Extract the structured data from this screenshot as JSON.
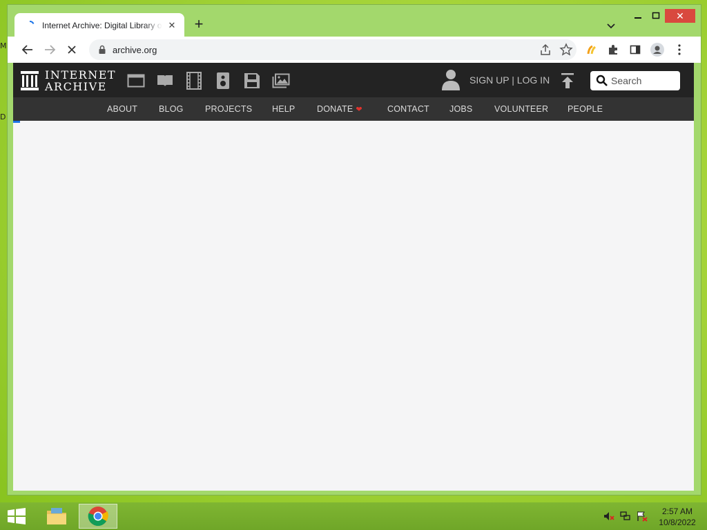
{
  "desktop": {
    "edge_labels": [
      "M",
      "D"
    ]
  },
  "browser": {
    "tab": {
      "title": "Internet Archive: Digital Library of Free & Borrowable Books, Movies, Music & Wayback Machine"
    },
    "url": "archive.org",
    "state": "loading"
  },
  "site": {
    "logo": {
      "line1": "INTERNET",
      "line2": "ARCHIVE"
    },
    "media_icons": [
      "web-icon",
      "texts-icon",
      "video-icon",
      "audio-icon",
      "software-icon",
      "images-icon"
    ],
    "account_link": "SIGN UP | LOG IN",
    "search_placeholder": "Search",
    "nav": [
      {
        "label": "ABOUT"
      },
      {
        "label": "BLOG"
      },
      {
        "label": "PROJECTS"
      },
      {
        "label": "HELP"
      },
      {
        "label": "DONATE"
      },
      {
        "label": "CONTACT"
      },
      {
        "label": "JOBS"
      },
      {
        "label": "VOLUNTEER"
      },
      {
        "label": "PEOPLE"
      }
    ],
    "colors": {
      "header_bg": "#232323",
      "nav_bg": "#333333",
      "donate_heart": "#e0332d"
    }
  },
  "taskbar": {
    "time": "2:57 AM",
    "date": "10/8/2022",
    "apps": [
      "file-explorer-icon",
      "chrome-icon"
    ]
  }
}
